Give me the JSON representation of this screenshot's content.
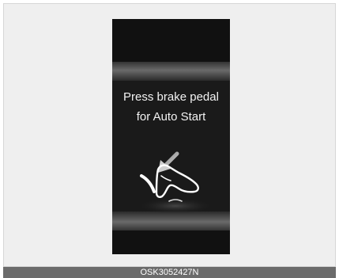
{
  "display": {
    "message_line1": "Press brake pedal",
    "message_line2": "for Auto Start",
    "icon": "brake-pedal-foot-icon",
    "colors": {
      "background": "#111111",
      "text": "#f2f2f2",
      "icon": "#ffffff"
    }
  },
  "caption": {
    "code": "OSK3052427N"
  }
}
